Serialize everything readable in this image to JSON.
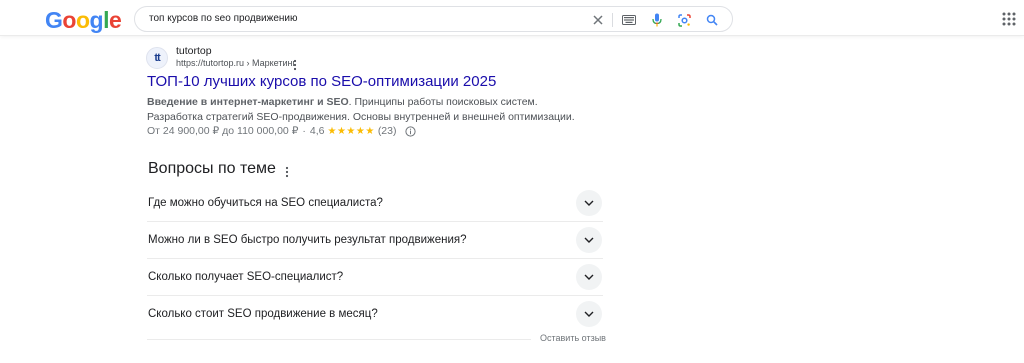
{
  "header": {
    "logo_letters": [
      {
        "ch": "G",
        "color": "#4285f4"
      },
      {
        "ch": "o",
        "color": "#ea4335"
      },
      {
        "ch": "o",
        "color": "#fbbc05"
      },
      {
        "ch": "g",
        "color": "#4285f4"
      },
      {
        "ch": "l",
        "color": "#34a853"
      },
      {
        "ch": "e",
        "color": "#ea4335"
      }
    ],
    "search_query": "топ курсов по seo продвижению",
    "icons": [
      "clear-icon",
      "keyboard-icon",
      "microphone-icon",
      "lens-icon",
      "search-icon",
      "apps-icon"
    ]
  },
  "result": {
    "favicon_text": "tt",
    "site_name": "tutortop",
    "site_url": "https://tutortop.ru › Маркетинг",
    "title": "ТОП-10 лучших курсов по SEO-оптимизации 2025",
    "snippet_bold": "Введение в интернет-маркетинг и SEO",
    "snippet_rest": ". Принципы работы поисковых систем. Разработка стратегий SEO-продвижения. Основы внутренней и внешней оптимизации.",
    "price_range": "От 24 900,00 ₽ до 110 000,00 ₽",
    "separator": "·",
    "rating": "4,6",
    "stars": "★★★★★",
    "rating_count": "(23)"
  },
  "paa": {
    "title": "Вопросы по теме",
    "questions": [
      "Где можно обучиться на SEO специалиста?",
      "Можно ли в SEO быстро получить результат продвижения?",
      "Сколько получает SEO-специалист?",
      "Сколько стоит SEO продвижение в месяц?"
    ],
    "feedback": "Оставить отзыв"
  },
  "colors": {
    "link": "#1a0dab",
    "star": "#fbbc04",
    "mic_blue": "#4285f4"
  }
}
